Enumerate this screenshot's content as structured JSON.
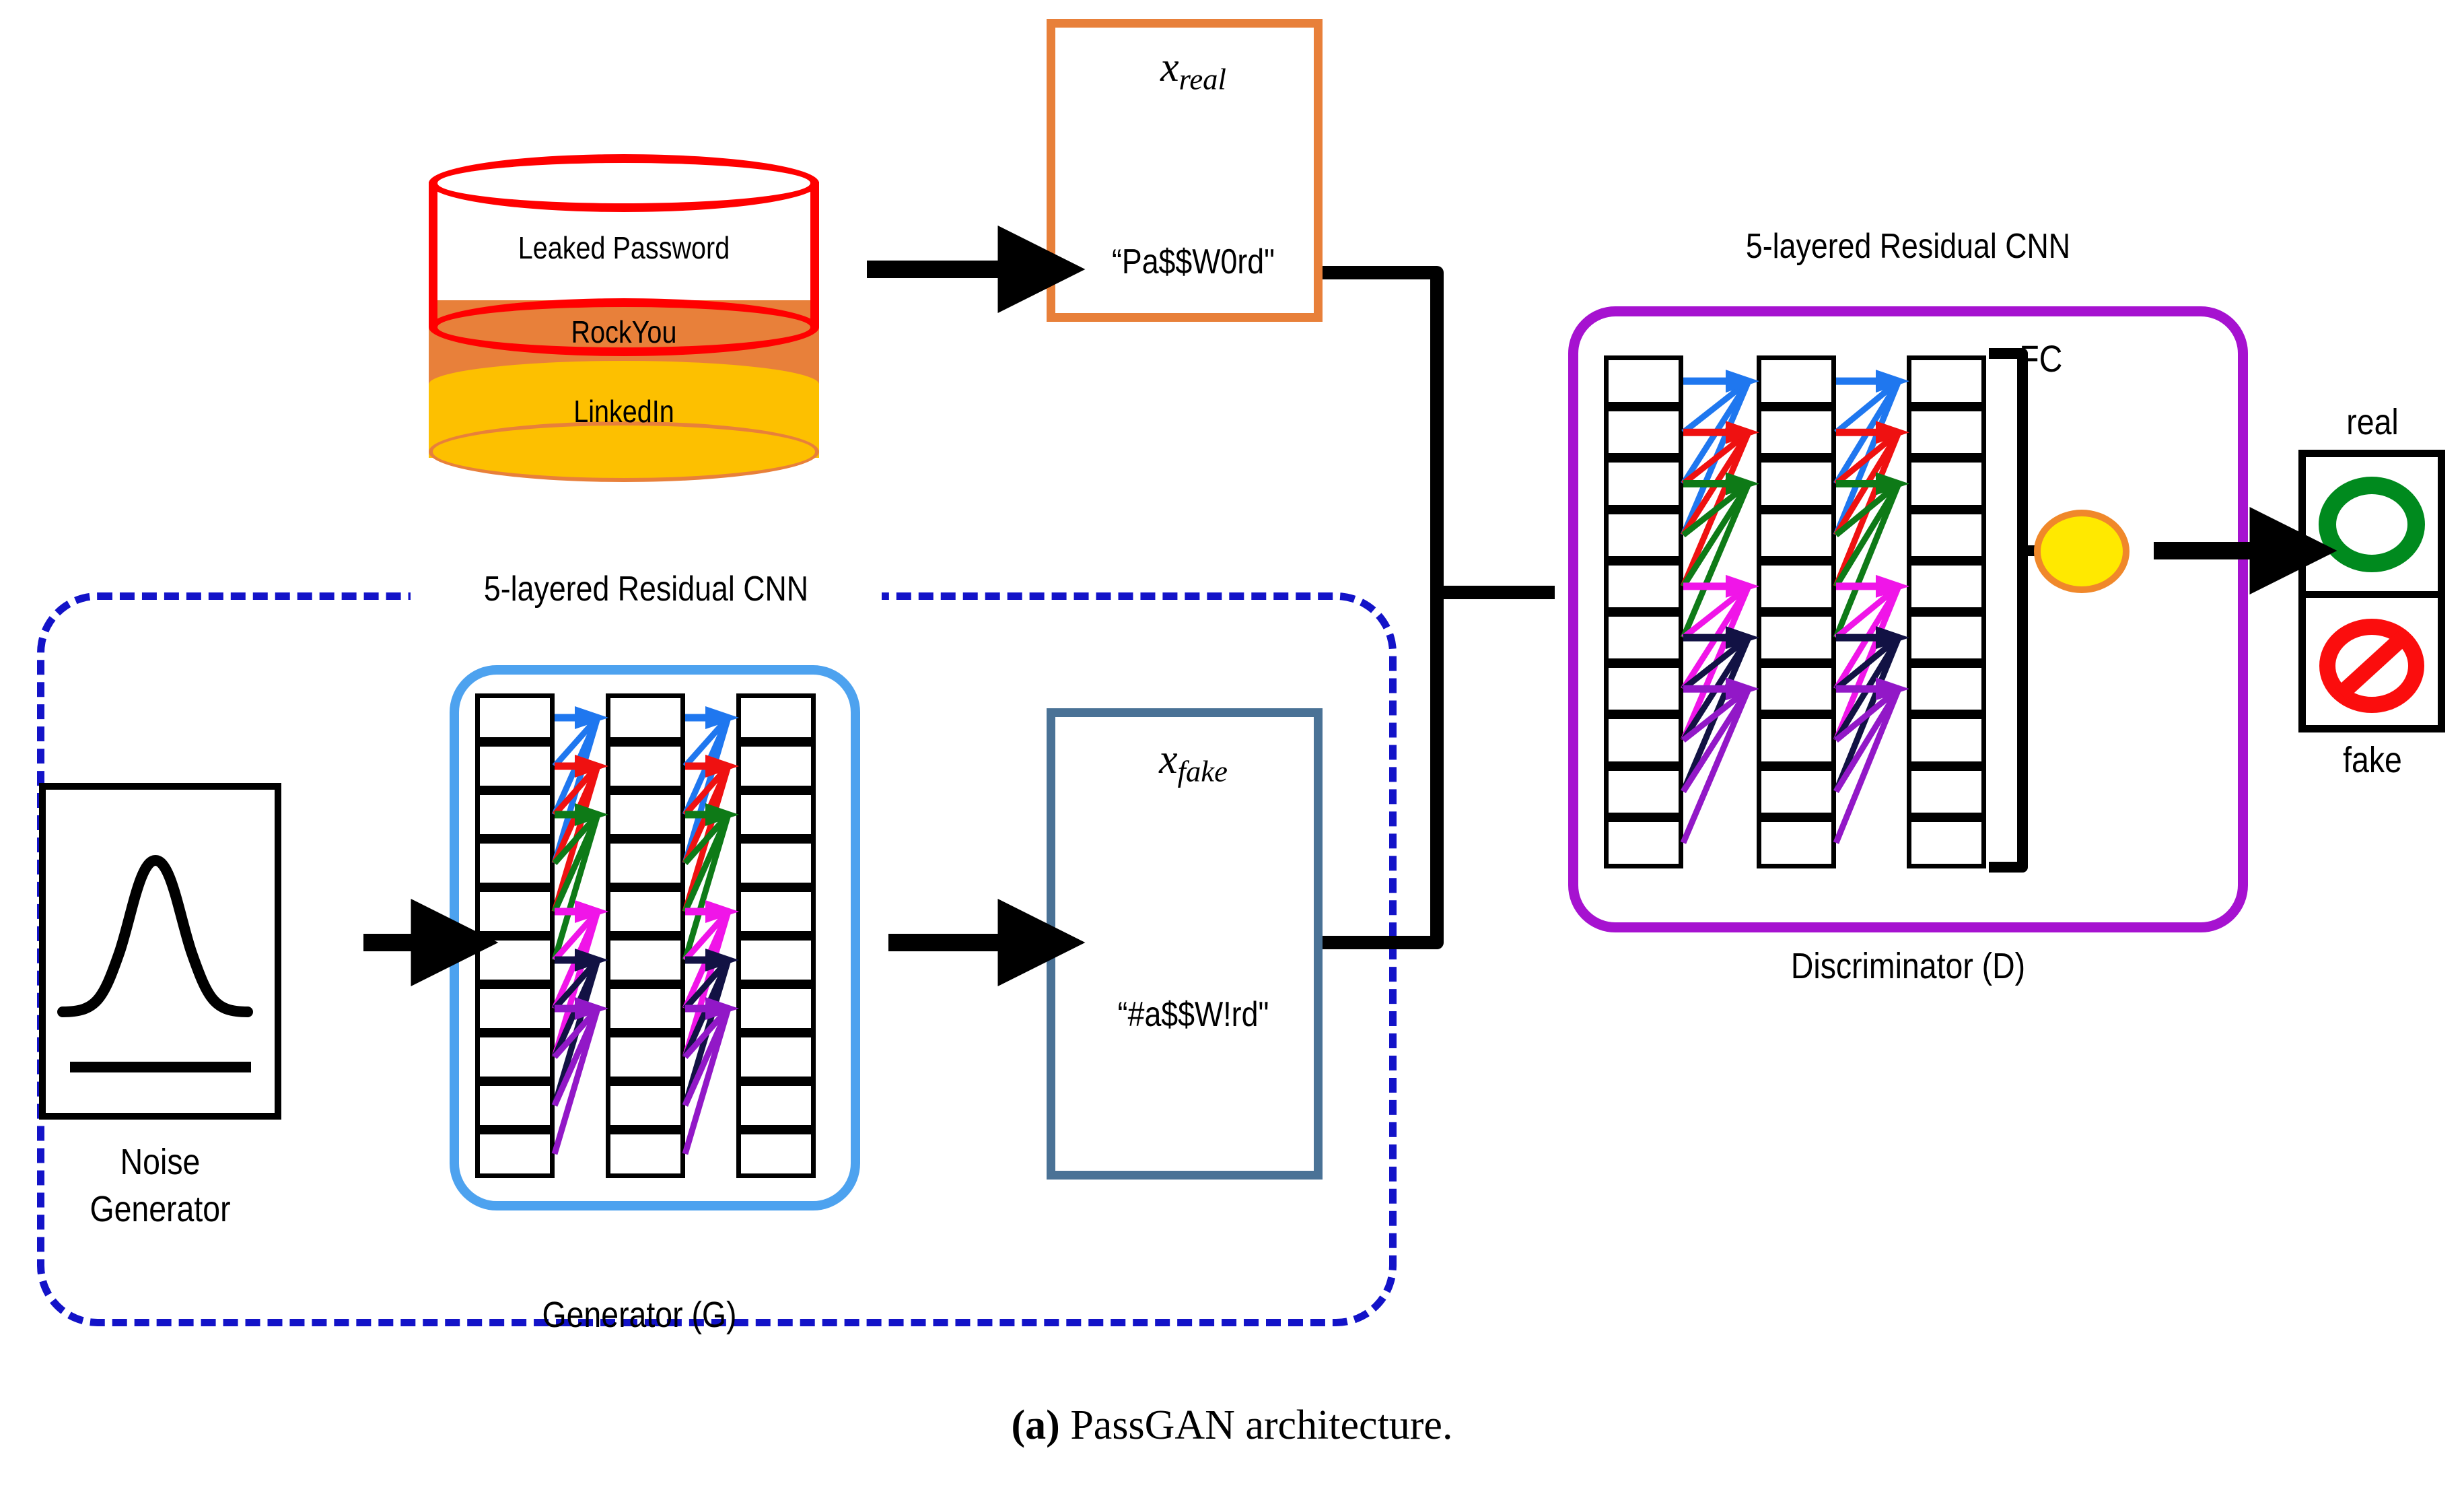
{
  "diagram": {
    "title": "PassGAN architecture",
    "caption_prefix": "(a)",
    "caption_text": "PassGAN architecture."
  },
  "database": {
    "top_label": "Leaked Password",
    "mid_label": "RockYou",
    "bottom_label": "LinkedIn",
    "outline_color": "#ff0000",
    "mid_color": "#e8803a",
    "bottom_color": "#fdc000"
  },
  "x_real_box": {
    "symbol_base": "x",
    "symbol_sub": "real",
    "value": "“Pa$$W0rd\"",
    "border_color": "#e8803a"
  },
  "x_fake_box": {
    "symbol_base": "x",
    "symbol_sub": "fake",
    "value": "“#a$$W!rd\"",
    "border_color": "#4a7296"
  },
  "noise": {
    "label_line1": "Noise",
    "label_line2": "Generator",
    "icon": "gaussian-curve-icon"
  },
  "generator": {
    "outer_label": "Generator (G)",
    "cnn_label": "5-layered Residual CNN",
    "dash_color": "#1313c8",
    "cnn_border_color": "#4da2ef"
  },
  "discriminator": {
    "outer_label": "Discriminator (D)",
    "cnn_label": "5-layered Residual CNN",
    "border_color": "#a612d0",
    "fc_label": "FC",
    "output_node": "sigmoid-output-node",
    "node_fill": "#ffe900",
    "node_stroke": "#f0882a"
  },
  "output_box": {
    "top_label": "real",
    "bottom_label": "fake",
    "real_icon": "green-circle-icon",
    "fake_icon": "red-prohibition-icon",
    "real_color": "#008a1e",
    "fake_color": "#fb0d0d"
  },
  "cnn": {
    "columns": 3,
    "cells_per_column": 10,
    "arrow_colors": [
      "#1f77ef",
      "#ef1111",
      "#0e7a17",
      "#f015e8",
      "#121244",
      "#9218c7"
    ]
  }
}
